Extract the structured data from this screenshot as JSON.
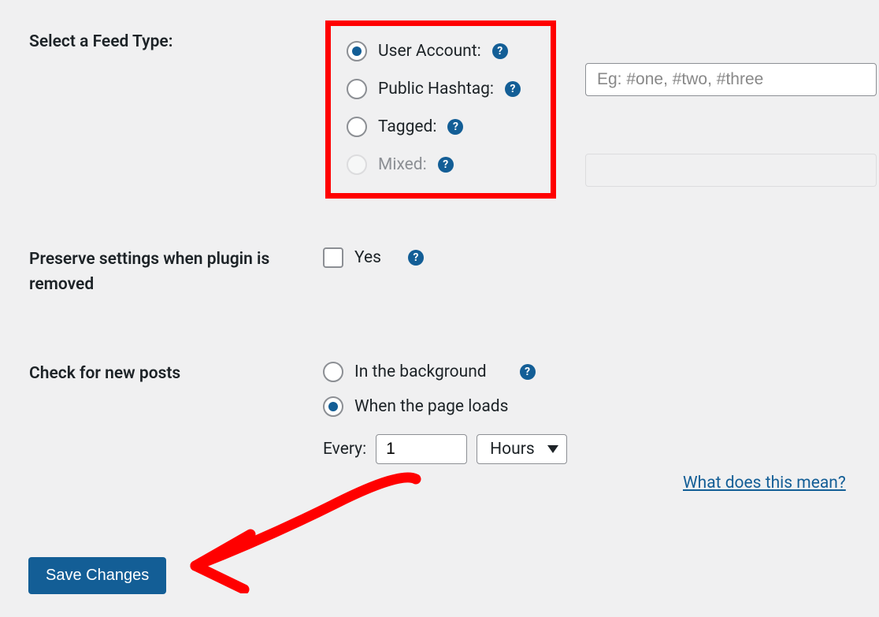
{
  "feed_type": {
    "label": "Select a Feed Type:",
    "options": {
      "user_account": "User Account:",
      "public_hashtag": "Public Hashtag:",
      "tagged": "Tagged:",
      "mixed": "Mixed:"
    },
    "hashtag_placeholder": "Eg: #one, #two, #three"
  },
  "preserve": {
    "label": "Preserve settings when plugin is removed",
    "checkbox_label": "Yes"
  },
  "check_posts": {
    "label": "Check for new posts",
    "background_label": "In the background",
    "page_loads_label": "When the page loads",
    "every_label": "Every:",
    "every_value": "1",
    "unit_selected": "Hours",
    "help_link": "What does this mean?"
  },
  "save_button_label": "Save Changes"
}
